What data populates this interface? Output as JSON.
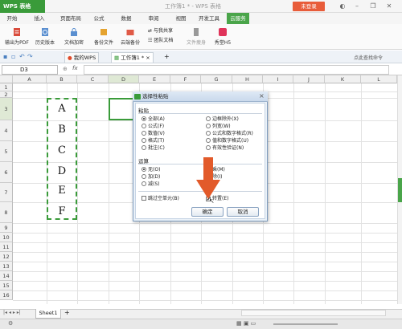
{
  "app": {
    "name": "WPS 表格",
    "title": "工作簿1 * - WPS 表格",
    "login_label": "未登录"
  },
  "ribbon_tabs": [
    "开始",
    "插入",
    "页面布局",
    "公式",
    "数据",
    "审阅",
    "视图",
    "开发工具",
    "云服务"
  ],
  "ribbon_buttons": [
    "输出为PDF",
    "历史版本",
    "文档加密",
    "备份文件",
    "云端备份",
    "团队文档",
    "文件瘦身",
    "秀堂H5"
  ],
  "ribbon_small": {
    "share": "与我共享"
  },
  "doc_tabs": {
    "mywps": "我的WPS",
    "workbook": "工作簿1 *"
  },
  "quick_right": "点此查找命令",
  "formula": {
    "cell_ref": "D3",
    "fx": "fx"
  },
  "columns": [
    "A",
    "B",
    "C",
    "D",
    "E",
    "F",
    "G",
    "H",
    "I",
    "J",
    "K",
    "L"
  ],
  "rows": [
    "1",
    "2",
    "3",
    "4",
    "5",
    "6",
    "7",
    "8",
    "9",
    "10",
    "11",
    "12",
    "13",
    "14",
    "15",
    "16"
  ],
  "cells": [
    "A",
    "B",
    "C",
    "D",
    "E",
    "F"
  ],
  "dialog": {
    "title": "选择性粘贴",
    "paste_label": "粘贴",
    "paste_left": [
      "全部(A)",
      "公式(F)",
      "数值(V)",
      "格式(T)",
      "批注(C)"
    ],
    "paste_right": [
      "边框除外(X)",
      "列宽(W)",
      "公式和数字格式(R)",
      "值和数字格式(U)",
      "有效性验证(N)"
    ],
    "op_label": "运算",
    "op_left": [
      "无(O)",
      "加(D)",
      "减(S)"
    ],
    "op_right": [
      "乘(M)",
      "除(I)"
    ],
    "skip_blanks": "跳过空单元(B)",
    "transpose": "转置(E)",
    "ok": "确定",
    "cancel": "取消"
  },
  "sheet_tab": "Sheet1",
  "colors": {
    "accent": "#3a9b3a",
    "arrow": "#e25a2a"
  }
}
